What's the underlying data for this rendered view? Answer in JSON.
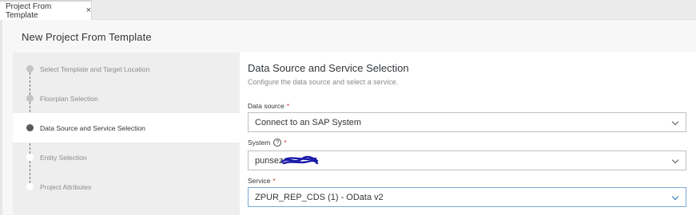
{
  "tab": {
    "label": "Project From Template",
    "close_glyph": "×"
  },
  "dialog": {
    "title": "New Project From Template"
  },
  "steps": [
    {
      "label": "Select Template and Target Location",
      "state": "done"
    },
    {
      "label": "Floorplan Selection",
      "state": "done"
    },
    {
      "label": "Data Source and Service Selection",
      "state": "current"
    },
    {
      "label": "Entity Selection",
      "state": "future"
    },
    {
      "label": "Project Attributes",
      "state": "future"
    }
  ],
  "section": {
    "title": "Data Source and Service Selection",
    "description": "Configure the data source and select a service."
  },
  "fields": {
    "data_source": {
      "label": "Data source",
      "required_mark": "*",
      "value": "Connect to an SAP System"
    },
    "system": {
      "label": "System",
      "help_glyph": "?",
      "required_mark": "*",
      "value": "punsez"
    },
    "service": {
      "label": "Service",
      "required_mark": "*",
      "value": "ZPUR_REP_CDS (1) - OData v2"
    }
  },
  "colors": {
    "accent": "#2a6fb6",
    "required": "#c0392b",
    "redaction": "#1a1aa8"
  },
  "icons": {
    "help": "help-circle-icon",
    "chevron": "chevron-down-icon",
    "close": "close-icon"
  }
}
